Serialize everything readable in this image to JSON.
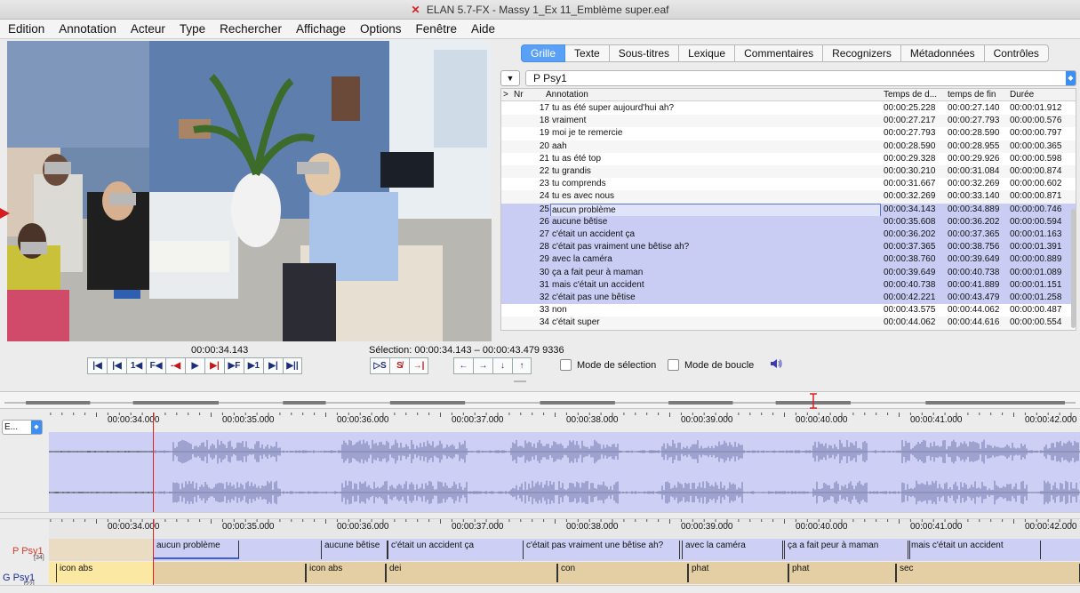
{
  "window": {
    "title": "ELAN 5.7-FX - Massy 1_Ex 11_Emblème super.eaf",
    "logo_glyph": "✕"
  },
  "menu": [
    "Edition",
    "Annotation",
    "Acteur",
    "Type",
    "Rechercher",
    "Affichage",
    "Options",
    "Fenêtre",
    "Aide"
  ],
  "player": {
    "timecode": "00:00:34.143",
    "selection": "Sélection: 00:00:34.143 – 00:00:43.479  9336",
    "transport_buttons": [
      "|◀",
      "|◀",
      "1◀",
      "F◀",
      "-◀",
      "▶",
      "▶|",
      "▶F",
      "▶1",
      "▶|",
      "▶||"
    ],
    "selection_buttons": [
      "▷S",
      "S̸",
      "→|"
    ],
    "arrow_buttons": [
      "←",
      "→",
      "↓",
      "↑"
    ],
    "mode_selection_label": "Mode de sélection",
    "mode_boucle_label": "Mode de boucle",
    "speaker_icon": "speaker-icon"
  },
  "tabs": [
    "Grille",
    "Texte",
    "Sous-titres",
    "Lexique",
    "Commentaires",
    "Recognizers",
    "Métadonnées",
    "Contrôles"
  ],
  "active_tab": "Grille",
  "tier_selector": {
    "toggle": "▼",
    "value": "P Psy1"
  },
  "grid": {
    "headers": {
      "sort": ">",
      "nr": "Nr",
      "annotation": "Annotation",
      "start": "Temps de d...",
      "end": "temps de fin",
      "duration": "Durée"
    },
    "rows": [
      {
        "nr": "17",
        "annotation": "tu as été super aujourd'hui ah?",
        "start": "00:00:25.228",
        "end": "00:00:27.140",
        "duration": "00:00:01.912"
      },
      {
        "nr": "18",
        "annotation": "vraiment",
        "start": "00:00:27.217",
        "end": "00:00:27.793",
        "duration": "00:00:00.576"
      },
      {
        "nr": "19",
        "annotation": "moi je te remercie",
        "start": "00:00:27.793",
        "end": "00:00:28.590",
        "duration": "00:00:00.797"
      },
      {
        "nr": "20",
        "annotation": "aah",
        "start": "00:00:28.590",
        "end": "00:00:28.955",
        "duration": "00:00:00.365"
      },
      {
        "nr": "21",
        "annotation": "tu as été top",
        "start": "00:00:29.328",
        "end": "00:00:29.926",
        "duration": "00:00:00.598"
      },
      {
        "nr": "22",
        "annotation": "tu grandis",
        "start": "00:00:30.210",
        "end": "00:00:31.084",
        "duration": "00:00:00.874"
      },
      {
        "nr": "23",
        "annotation": "tu comprends",
        "start": "00:00:31.667",
        "end": "00:00:32.269",
        "duration": "00:00:00.602"
      },
      {
        "nr": "24",
        "annotation": "tu es avec nous",
        "start": "00:00:32.269",
        "end": "00:00:33.140",
        "duration": "00:00:00.871"
      },
      {
        "nr": "25",
        "annotation": "aucun problème",
        "start": "00:00:34.143",
        "end": "00:00:34.889",
        "duration": "00:00:00.746"
      },
      {
        "nr": "26",
        "annotation": "aucune bêtise",
        "start": "00:00:35.608",
        "end": "00:00:36.202",
        "duration": "00:00:00.594"
      },
      {
        "nr": "27",
        "annotation": "c'était un accident ça",
        "start": "00:00:36.202",
        "end": "00:00:37.365",
        "duration": "00:00:01.163"
      },
      {
        "nr": "28",
        "annotation": "c'était pas vraiment une bêtise ah?",
        "start": "00:00:37.365",
        "end": "00:00:38.756",
        "duration": "00:00:01.391"
      },
      {
        "nr": "29",
        "annotation": "avec la caméra",
        "start": "00:00:38.760",
        "end": "00:00:39.649",
        "duration": "00:00:00.889"
      },
      {
        "nr": "30",
        "annotation": "ça a fait peur à maman",
        "start": "00:00:39.649",
        "end": "00:00:40.738",
        "duration": "00:00:01.089"
      },
      {
        "nr": "31",
        "annotation": "mais c'était un accident",
        "start": "00:00:40.738",
        "end": "00:00:41.889",
        "duration": "00:00:01.151"
      },
      {
        "nr": "32",
        "annotation": "c'était pas une bêtise",
        "start": "00:00:42.221",
        "end": "00:00:43.479",
        "duration": "00:00:01.258"
      },
      {
        "nr": "33",
        "annotation": "non",
        "start": "00:00:43.575",
        "end": "00:00:44.062",
        "duration": "00:00:00.487"
      },
      {
        "nr": "34",
        "annotation": "c'était super",
        "start": "00:00:44.062",
        "end": "00:00:44.616",
        "duration": "00:00:00.554"
      }
    ],
    "current_nr": "25",
    "selected_nrs": [
      "25",
      "26",
      "27",
      "28",
      "29",
      "30",
      "31",
      "32"
    ]
  },
  "timeline": {
    "ruler_labels": [
      "00:00:34.000",
      "00:00:35.000",
      "00:00:36.000",
      "00:00:37.000",
      "00:00:38.000",
      "00:00:39.000",
      "00:00:40.000",
      "00:00:41.000",
      "00:00:42.000"
    ],
    "waveform_selector": "E...",
    "tiers": [
      {
        "name": "P Psy1",
        "count": "[34]",
        "color": "#d93a2a",
        "segments": [
          {
            "label": "aucun problème"
          },
          {
            "label": "aucune bêtise"
          },
          {
            "label": "c'était un accident ça"
          },
          {
            "label": "c'était pas vraiment une bêtise ah?"
          },
          {
            "label": "avec la caméra"
          },
          {
            "label": "ça a fait peur à maman"
          },
          {
            "label": "mais c'était un accident"
          }
        ]
      },
      {
        "name": "G Psy1",
        "count": "[22]",
        "color": "#1a2c9a",
        "segments": [
          {
            "label": "icon abs"
          },
          {
            "label": "icon abs"
          },
          {
            "label": "dei"
          },
          {
            "label": "con"
          },
          {
            "label": "phat"
          },
          {
            "label": "phat"
          },
          {
            "label": "sec"
          }
        ]
      }
    ]
  },
  "colors": {
    "accent": "#5aa0f5",
    "selection_band": "#cdd0f4",
    "waveform": "#8f93c2",
    "cursor": "#e02020",
    "tier_bg": "#e9d8b6",
    "tier_highlight": "#fbe8a2"
  }
}
